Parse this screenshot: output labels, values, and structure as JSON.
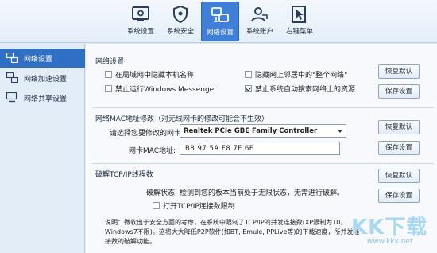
{
  "toolbar": {
    "items": [
      {
        "label": "系统设置",
        "icon": "system-settings-icon"
      },
      {
        "label": "系统安全",
        "icon": "shield-icon"
      },
      {
        "label": "网络设置",
        "icon": "network-icon"
      },
      {
        "label": "系统账户",
        "icon": "user-icon"
      },
      {
        "label": "右键菜单",
        "icon": "cursor-menu-icon"
      }
    ],
    "active": "网络设置"
  },
  "sidebar": {
    "items": [
      {
        "label": "网络设置",
        "icon": "network-settings-icon"
      },
      {
        "label": "网络加速设置",
        "icon": "network-speed-icon"
      },
      {
        "label": "网络共享设置",
        "icon": "network-share-icon"
      }
    ],
    "active": "网络设置"
  },
  "network_section": {
    "title": "网络设置",
    "options": [
      {
        "label": "在局域网中隐藏本机名称",
        "checked": false
      },
      {
        "label": "隐藏网上邻居中的\"整个网络\"",
        "checked": false
      },
      {
        "label": "禁止运行Windows Messenger",
        "checked": false
      },
      {
        "label": "禁止系统自动搜索网络上的资源",
        "checked": true
      }
    ],
    "restore_label": "恢复默认",
    "save_label": "保存设置"
  },
  "mac_section": {
    "title": "网络MAC地址修改（对无线网卡的修改可能会不生效）",
    "nic_label": "请选择您要修改的网卡:",
    "nic_value": "Realtek PCIe GBE Family Controller",
    "mac_label": "网卡MAC地址:",
    "mac_value": "B8 97 5A F8 7F 6F",
    "restore_label": "恢复默认",
    "save_label": "保存设置"
  },
  "tcp_section": {
    "title": "破解TCP/IP线程数",
    "status_label": "破解状态:",
    "status_value": "检测到您的板本当前处于无限状态，无需进行破解。",
    "option_label": "打开TCP/IP连接数限制",
    "option_checked": false,
    "note": "说明：微软出于安全方面的考虑，在系统中限制了TCP/IP的并发连接数(XP限制为10，Windows7不限)。这将大大降低P2P软件(如BT, Emule, PPLive等)的下载速度，所并发连接数的破解功能。",
    "restore_label": "恢复默认",
    "save_label": "保存设置"
  },
  "watermark": {
    "big": "KK下载",
    "small": "www.kkx.net"
  },
  "colors": {
    "accent": "#3f7fd8",
    "sidebar_active": "#2f6fc6",
    "background": "#dfeaf6"
  }
}
